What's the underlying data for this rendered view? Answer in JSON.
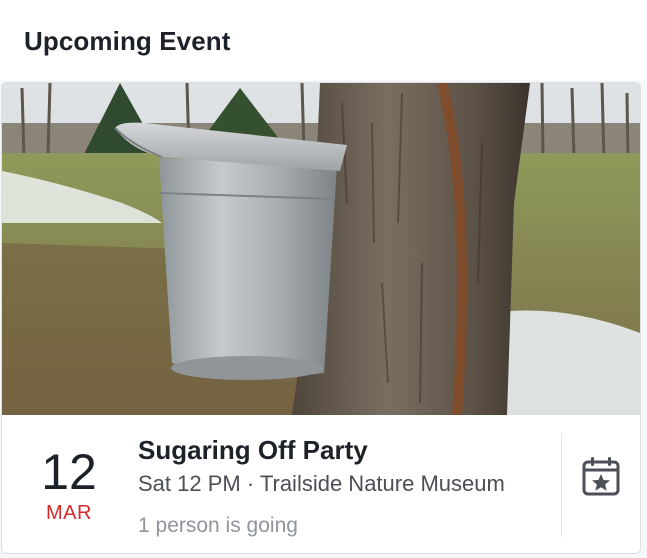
{
  "header": {
    "title": "Upcoming Event"
  },
  "event": {
    "date_day": "12",
    "date_month": "MAR",
    "title": "Sugaring Off Party",
    "meta": "Sat 12 PM · Trailside Nature Museum",
    "going": "1 person is going"
  },
  "icons": {
    "calendar": "calendar-star-icon"
  },
  "colors": {
    "month_accent": "#d8282b",
    "calendar_icon": "#4b4f56"
  }
}
